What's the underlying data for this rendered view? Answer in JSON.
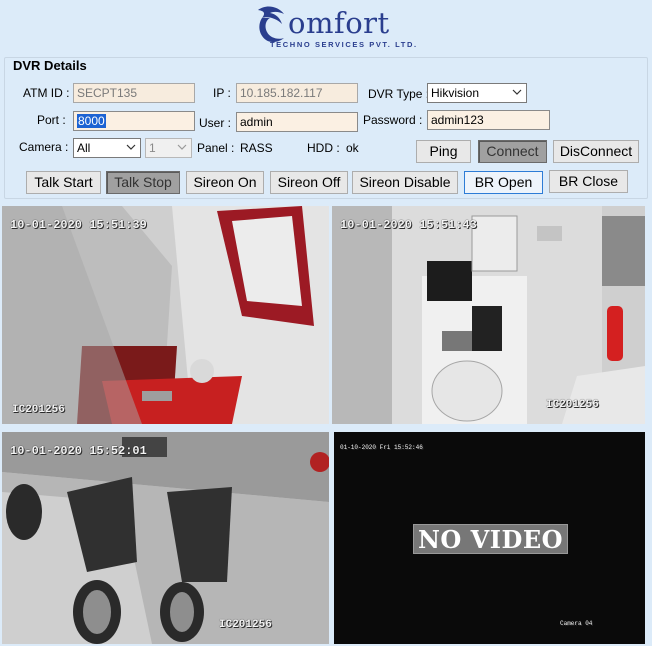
{
  "brand": {
    "name": "omfort",
    "tagline": "TECHNO SERVICES PVT. LTD."
  },
  "panel": {
    "title": "DVR Details"
  },
  "form": {
    "atm_id_label": "ATM ID :",
    "atm_id_value": "SECPT135",
    "ip_label": "IP :",
    "ip_value": "10.185.182.117",
    "dvr_type_label": "DVR Type :",
    "dvr_type_value": "Hikvision",
    "port_label": "Port :",
    "port_value": "8000",
    "user_label": "User :",
    "user_value": "admin",
    "password_label": "Password :",
    "password_value": "admin123",
    "camera_label": "Camera :",
    "camera_value": "All",
    "camera_num_value": "1",
    "panel_label": "Panel :",
    "panel_value": "RASS",
    "hdd_label": "HDD :",
    "hdd_value": "ok"
  },
  "buttons": {
    "ping": "Ping",
    "connect": "Connect",
    "disconnect": "DisConnect",
    "talk_start": "Talk Start",
    "talk_stop": "Talk Stop",
    "sireon_on": "Sireon On",
    "sireon_off": "Sireon Off",
    "sireon_disable": "Sireon Disable",
    "br_open": "BR Open",
    "br_close": "BR Close"
  },
  "cameras": [
    {
      "timestamp": "10-01-2020 15:51:39",
      "label": "IC201256"
    },
    {
      "timestamp": "10-01-2020 15:51:43",
      "label": "IC201256"
    },
    {
      "timestamp": "10-01-2020 15:52:01",
      "label": "IC201256"
    },
    {
      "timestamp": "01-10-2020 Fri 15:52:46",
      "message": "NO VIDEO",
      "label": "Camera 04"
    }
  ]
}
